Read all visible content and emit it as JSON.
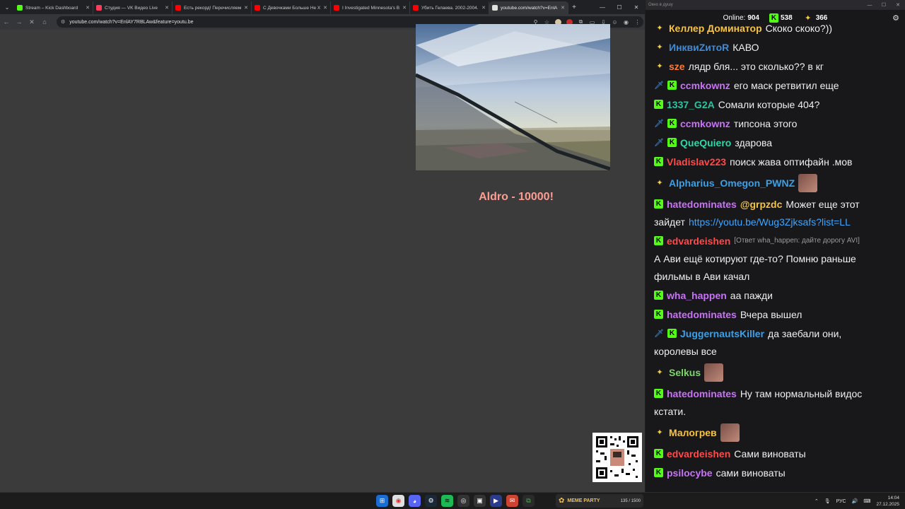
{
  "browser": {
    "tabs": [
      {
        "title": "Stream – Kick Dashboard",
        "color": "#53fc18",
        "active": false
      },
      {
        "title": "Студия — VK Видео Live",
        "color": "#ff3b5c",
        "active": false
      },
      {
        "title": "Есть рекорд! Перечисляем",
        "color": "#ff0000",
        "active": false
      },
      {
        "title": "С Девочками Больше Не Х",
        "color": "#ff0000",
        "active": false
      },
      {
        "title": "I Investigated Minnesota's B",
        "color": "#ff0000",
        "active": false
      },
      {
        "title": "Убить Гелаева. 2002-2004.",
        "color": "#ff0000",
        "active": false
      },
      {
        "title": "youtube.com/watch?v=EnlA",
        "color": "#e0e0e0",
        "active": true
      }
    ],
    "url": "youtube.com/watch?v=EnlAY7RBLAw&feature=youtu.be"
  },
  "overlay": {
    "donation_text": "Aldro - 10000!"
  },
  "chat": {
    "window_title": "Окно в душу",
    "online_label": "Online:",
    "online_count": "904",
    "kick_count": "538",
    "vk_count": "366",
    "messages": [
      {
        "badges": [
          "pig"
        ],
        "user": "Келлер Доминатор",
        "color": "#f6c344",
        "text": "Скоко скоко?))"
      },
      {
        "badges": [
          "pig"
        ],
        "user": "ИнквиZитоR",
        "color": "#3e8bd6",
        "text": "КАВО"
      },
      {
        "badges": [
          "pig"
        ],
        "user": "sze",
        "color": "#ff7a2f",
        "text": "лядр бля... это сколько?? в кг"
      },
      {
        "badges": [
          "sword",
          "kick"
        ],
        "user": "ccmkownz",
        "color": "#c873f5",
        "text": "его маск ретвитил еще"
      },
      {
        "badges": [
          "kick"
        ],
        "user": "1337_G2A",
        "color": "#2fc3a2",
        "text": "Сомали которые 404?"
      },
      {
        "badges": [
          "sword",
          "kick"
        ],
        "user": "ccmkownz",
        "color": "#c873f5",
        "text": "типсона этого"
      },
      {
        "badges": [
          "sword",
          "kick"
        ],
        "user": "QueQuiero",
        "color": "#2fd8a8",
        "text": "здарова"
      },
      {
        "badges": [
          "kick"
        ],
        "user": "Vladislav223",
        "color": "#ff4a4a",
        "text": "поиск жава оптифайн .мов"
      },
      {
        "badges": [
          "pig"
        ],
        "user": "Alpharius_Omegon_PWNZ",
        "color": "#3aa0e8",
        "text": "",
        "emote": true
      },
      {
        "badges": [
          "kick"
        ],
        "user": "hatedominates",
        "color": "#c873f5",
        "mention": "@grpzdc",
        "text": "Может еще этот",
        "line2": "зайдет",
        "link": "https://youtu.be/Wug3Zjksafs?list=LL"
      },
      {
        "badges": [
          "kick"
        ],
        "user": "edvardeishen",
        "color": "#ff4a4a",
        "reply": "[Ответ wha_happen: дайте дорогу AVI]",
        "line2": "А Ави ещё котируют где-то? Помню раньше",
        "line3": "фильмы в Ави качал"
      },
      {
        "badges": [
          "kick"
        ],
        "user": "wha_happen",
        "color": "#c873f5",
        "text": "аа пажди"
      },
      {
        "badges": [
          "kick"
        ],
        "user": "hatedominates",
        "color": "#c873f5",
        "text": "Вчера вышел"
      },
      {
        "badges": [
          "sword",
          "kick"
        ],
        "user": "JuggernautsKiller",
        "color": "#3aa0e8",
        "text": "да заебали они,",
        "line2": "королевы все"
      },
      {
        "badges": [
          "pig"
        ],
        "user": "Selkus",
        "color": "#7bd66a",
        "text": "",
        "emote": true
      },
      {
        "badges": [
          "kick"
        ],
        "user": "hatedominates",
        "color": "#c873f5",
        "text": "Ну там нормальный видос",
        "line2": "кстати."
      },
      {
        "badges": [
          "pig"
        ],
        "user": "Малогрев",
        "color": "#f6c344",
        "text": "",
        "emote": true
      },
      {
        "badges": [
          "kick"
        ],
        "user": "edvardeishen",
        "color": "#ff4a4a",
        "text": "Сами виноваты"
      },
      {
        "badges": [
          "kick"
        ],
        "user": "psilocybe",
        "color": "#c873f5",
        "text": "сами виноваты"
      }
    ]
  },
  "taskbar": {
    "widget_title": "MEME PARTY",
    "widget_progress": "135 / 1500",
    "lang": "РУС",
    "time": "14:04",
    "date": "27.12.2025"
  }
}
